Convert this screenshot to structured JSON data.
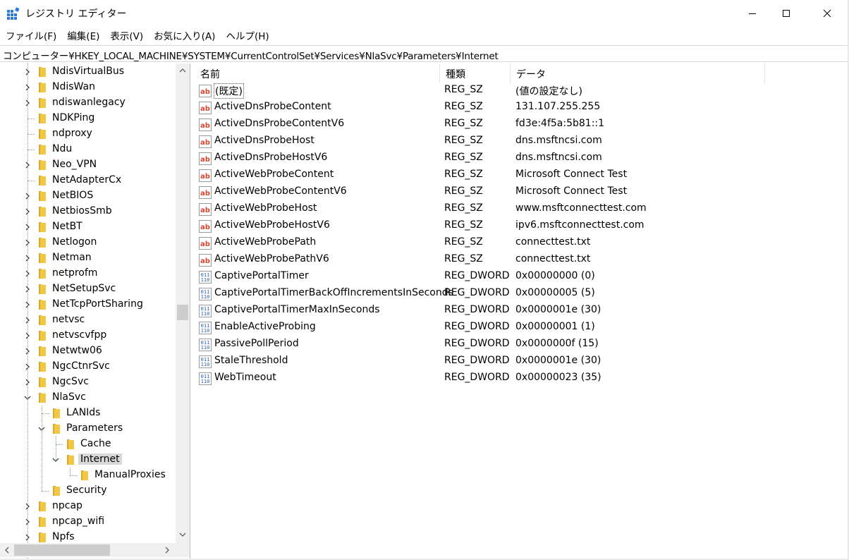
{
  "window": {
    "title": "レジストリ エディター"
  },
  "menu": [
    "ファイル(F)",
    "編集(E)",
    "表示(V)",
    "お気に入り(A)",
    "ヘルプ(H)"
  ],
  "address": "コンピューター¥HKEY_LOCAL_MACHINE¥SYSTEM¥CurrentControlSet¥Services¥NlaSvc¥Parameters¥Internet",
  "tree": [
    {
      "label": "NdisVirtualBus",
      "level": 0,
      "expander": "collapsed"
    },
    {
      "label": "NdisWan",
      "level": 0,
      "expander": "collapsed"
    },
    {
      "label": "ndiswanlegacy",
      "level": 0,
      "expander": "collapsed"
    },
    {
      "label": "NDKPing",
      "level": 0,
      "expander": "none"
    },
    {
      "label": "ndproxy",
      "level": 0,
      "expander": "none"
    },
    {
      "label": "Ndu",
      "level": 0,
      "expander": "none"
    },
    {
      "label": "Neo_VPN",
      "level": 0,
      "expander": "collapsed"
    },
    {
      "label": "NetAdapterCx",
      "level": 0,
      "expander": "none"
    },
    {
      "label": "NetBIOS",
      "level": 0,
      "expander": "collapsed"
    },
    {
      "label": "NetbiosSmb",
      "level": 0,
      "expander": "collapsed"
    },
    {
      "label": "NetBT",
      "level": 0,
      "expander": "collapsed"
    },
    {
      "label": "Netlogon",
      "level": 0,
      "expander": "collapsed"
    },
    {
      "label": "Netman",
      "level": 0,
      "expander": "collapsed"
    },
    {
      "label": "netprofm",
      "level": 0,
      "expander": "collapsed"
    },
    {
      "label": "NetSetupSvc",
      "level": 0,
      "expander": "collapsed"
    },
    {
      "label": "NetTcpPortSharing",
      "level": 0,
      "expander": "collapsed"
    },
    {
      "label": "netvsc",
      "level": 0,
      "expander": "collapsed"
    },
    {
      "label": "netvscvfpp",
      "level": 0,
      "expander": "collapsed"
    },
    {
      "label": "Netwtw06",
      "level": 0,
      "expander": "collapsed"
    },
    {
      "label": "NgcCtnrSvc",
      "level": 0,
      "expander": "collapsed"
    },
    {
      "label": "NgcSvc",
      "level": 0,
      "expander": "collapsed"
    },
    {
      "label": "NlaSvc",
      "level": 0,
      "expander": "expanded"
    },
    {
      "label": "LANIds",
      "level": 1,
      "expander": "none"
    },
    {
      "label": "Parameters",
      "level": 1,
      "expander": "expanded"
    },
    {
      "label": "Cache",
      "level": 2,
      "expander": "none"
    },
    {
      "label": "Internet",
      "level": 2,
      "expander": "expanded",
      "selected": true
    },
    {
      "label": "ManualProxies",
      "level": 3,
      "expander": "none"
    },
    {
      "label": "Security",
      "level": 1,
      "expander": "none"
    },
    {
      "label": "npcap",
      "level": 0,
      "expander": "collapsed"
    },
    {
      "label": "npcap_wifi",
      "level": 0,
      "expander": "collapsed"
    },
    {
      "label": "Npfs",
      "level": 0,
      "expander": "collapsed"
    }
  ],
  "columns": {
    "name": "名前",
    "type": "種類",
    "data": "データ"
  },
  "values": [
    {
      "icon": "string-value-icon",
      "name": "(既定)",
      "type": "REG_SZ",
      "data": "(値の設定なし)"
    },
    {
      "icon": "string-value-icon",
      "name": "ActiveDnsProbeContent",
      "type": "REG_SZ",
      "data": "131.107.255.255"
    },
    {
      "icon": "string-value-icon",
      "name": "ActiveDnsProbeContentV6",
      "type": "REG_SZ",
      "data": "fd3e:4f5a:5b81::1"
    },
    {
      "icon": "string-value-icon",
      "name": "ActiveDnsProbeHost",
      "type": "REG_SZ",
      "data": "dns.msftncsi.com"
    },
    {
      "icon": "string-value-icon",
      "name": "ActiveDnsProbeHostV6",
      "type": "REG_SZ",
      "data": "dns.msftncsi.com"
    },
    {
      "icon": "string-value-icon",
      "name": "ActiveWebProbeContent",
      "type": "REG_SZ",
      "data": "Microsoft Connect Test"
    },
    {
      "icon": "string-value-icon",
      "name": "ActiveWebProbeContentV6",
      "type": "REG_SZ",
      "data": "Microsoft Connect Test"
    },
    {
      "icon": "string-value-icon",
      "name": "ActiveWebProbeHost",
      "type": "REG_SZ",
      "data": "www.msftconnecttest.com"
    },
    {
      "icon": "string-value-icon",
      "name": "ActiveWebProbeHostV6",
      "type": "REG_SZ",
      "data": "ipv6.msftconnecttest.com"
    },
    {
      "icon": "string-value-icon",
      "name": "ActiveWebProbePath",
      "type": "REG_SZ",
      "data": "connecttest.txt"
    },
    {
      "icon": "string-value-icon",
      "name": "ActiveWebProbePathV6",
      "type": "REG_SZ",
      "data": "connecttest.txt"
    },
    {
      "icon": "dword-value-icon",
      "name": "CaptivePortalTimer",
      "type": "REG_DWORD",
      "data": "0x00000000 (0)"
    },
    {
      "icon": "dword-value-icon",
      "name": "CaptivePortalTimerBackOffIncrementsInSeconds",
      "type": "REG_DWORD",
      "data": "0x00000005 (5)"
    },
    {
      "icon": "dword-value-icon",
      "name": "CaptivePortalTimerMaxInSeconds",
      "type": "REG_DWORD",
      "data": "0x0000001e (30)"
    },
    {
      "icon": "dword-value-icon",
      "name": "EnableActiveProbing",
      "type": "REG_DWORD",
      "data": "0x00000001 (1)"
    },
    {
      "icon": "dword-value-icon",
      "name": "PassivePollPeriod",
      "type": "REG_DWORD",
      "data": "0x0000000f (15)"
    },
    {
      "icon": "dword-value-icon",
      "name": "StaleThreshold",
      "type": "REG_DWORD",
      "data": "0x0000001e (30)"
    },
    {
      "icon": "dword-value-icon",
      "name": "WebTimeout",
      "type": "REG_DWORD",
      "data": "0x00000023 (35)"
    }
  ],
  "colors": {
    "folder": "#f2c744",
    "folder_dark": "#d8a92a",
    "string_icon": "#d9472b",
    "dword_icon": "#2a5bb8",
    "selection": "#d9d9d9"
  }
}
